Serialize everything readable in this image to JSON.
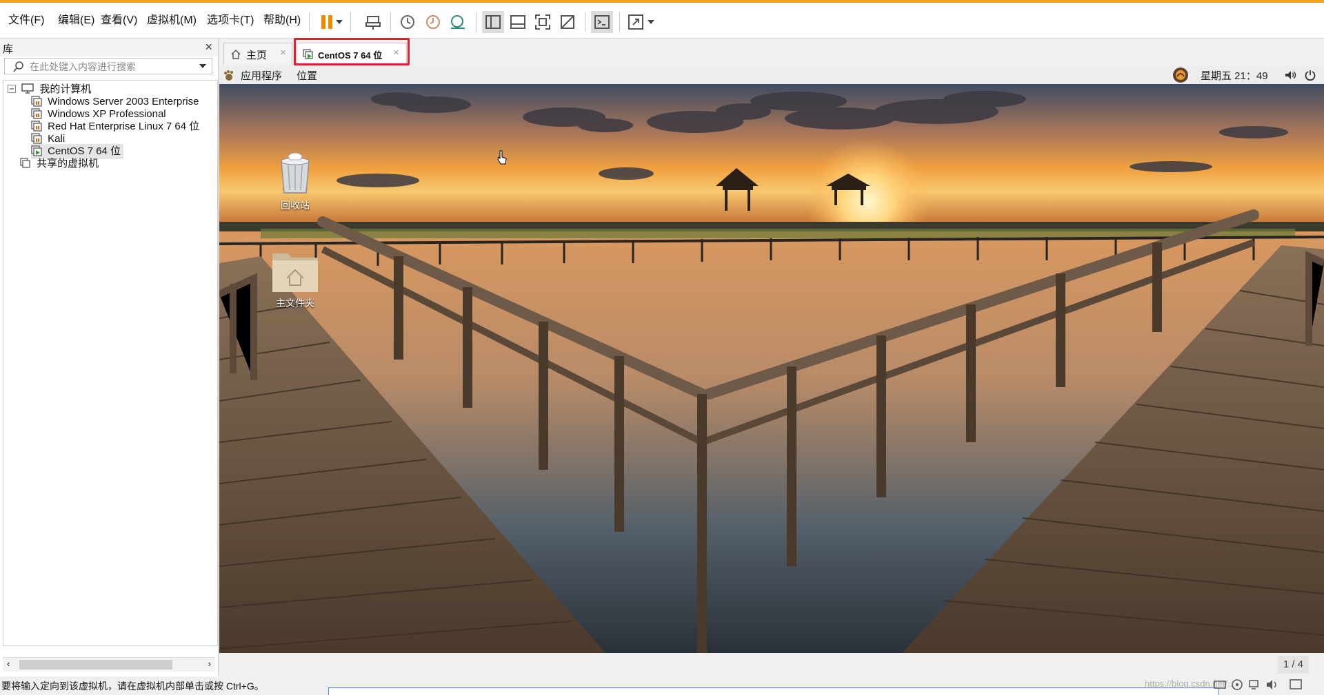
{
  "menus": [
    "文件(F)",
    "编辑(E)",
    "查看(V)",
    "虚拟机(M)",
    "选项卡(T)",
    "帮助(H)"
  ],
  "toolbar_icons": [
    "pause-icon",
    "dropdown-icon",
    "send-ctrl-alt-del-icon",
    "snapshot-icon",
    "revert-snapshot-icon",
    "snapshot-manager-icon",
    "library-view-icon",
    "thumbnail-view-icon",
    "fullscreen-icon",
    "unity-icon",
    "console-icon",
    "stretch-icon",
    "dropdown-icon"
  ],
  "library": {
    "title": "库",
    "search_placeholder": "在此处键入内容进行搜索",
    "tree": {
      "root": "我的计算机",
      "vms": [
        "Windows Server 2003 Enterprise",
        "Windows XP Professional",
        "Red Hat Enterprise Linux 7 64 位",
        "Kali",
        "CentOS 7 64 位"
      ],
      "shared": "共享的虚拟机"
    }
  },
  "tabs": [
    {
      "label": "主页",
      "icon": "home-icon"
    },
    {
      "label": "CentOS 7 64 位",
      "icon": "vm-icon",
      "active": true
    }
  ],
  "guest": {
    "topbar": {
      "applications": "应用程序",
      "places": "位置",
      "clock": "星期五 21：49"
    },
    "desktop_icons": [
      {
        "label": "回收站",
        "icon": "trash-icon"
      },
      {
        "label": "主文件夹",
        "icon": "home-folder-icon"
      }
    ],
    "pager": "1 / 4"
  },
  "status": {
    "message": "要将输入定向到该虚拟机，请在虚拟机内部单击或按 Ctrl+G。",
    "watermark": "https://blog.csdn.net/..."
  },
  "colors": {
    "highlight": "#e0202e",
    "accent": "#f2a227"
  }
}
